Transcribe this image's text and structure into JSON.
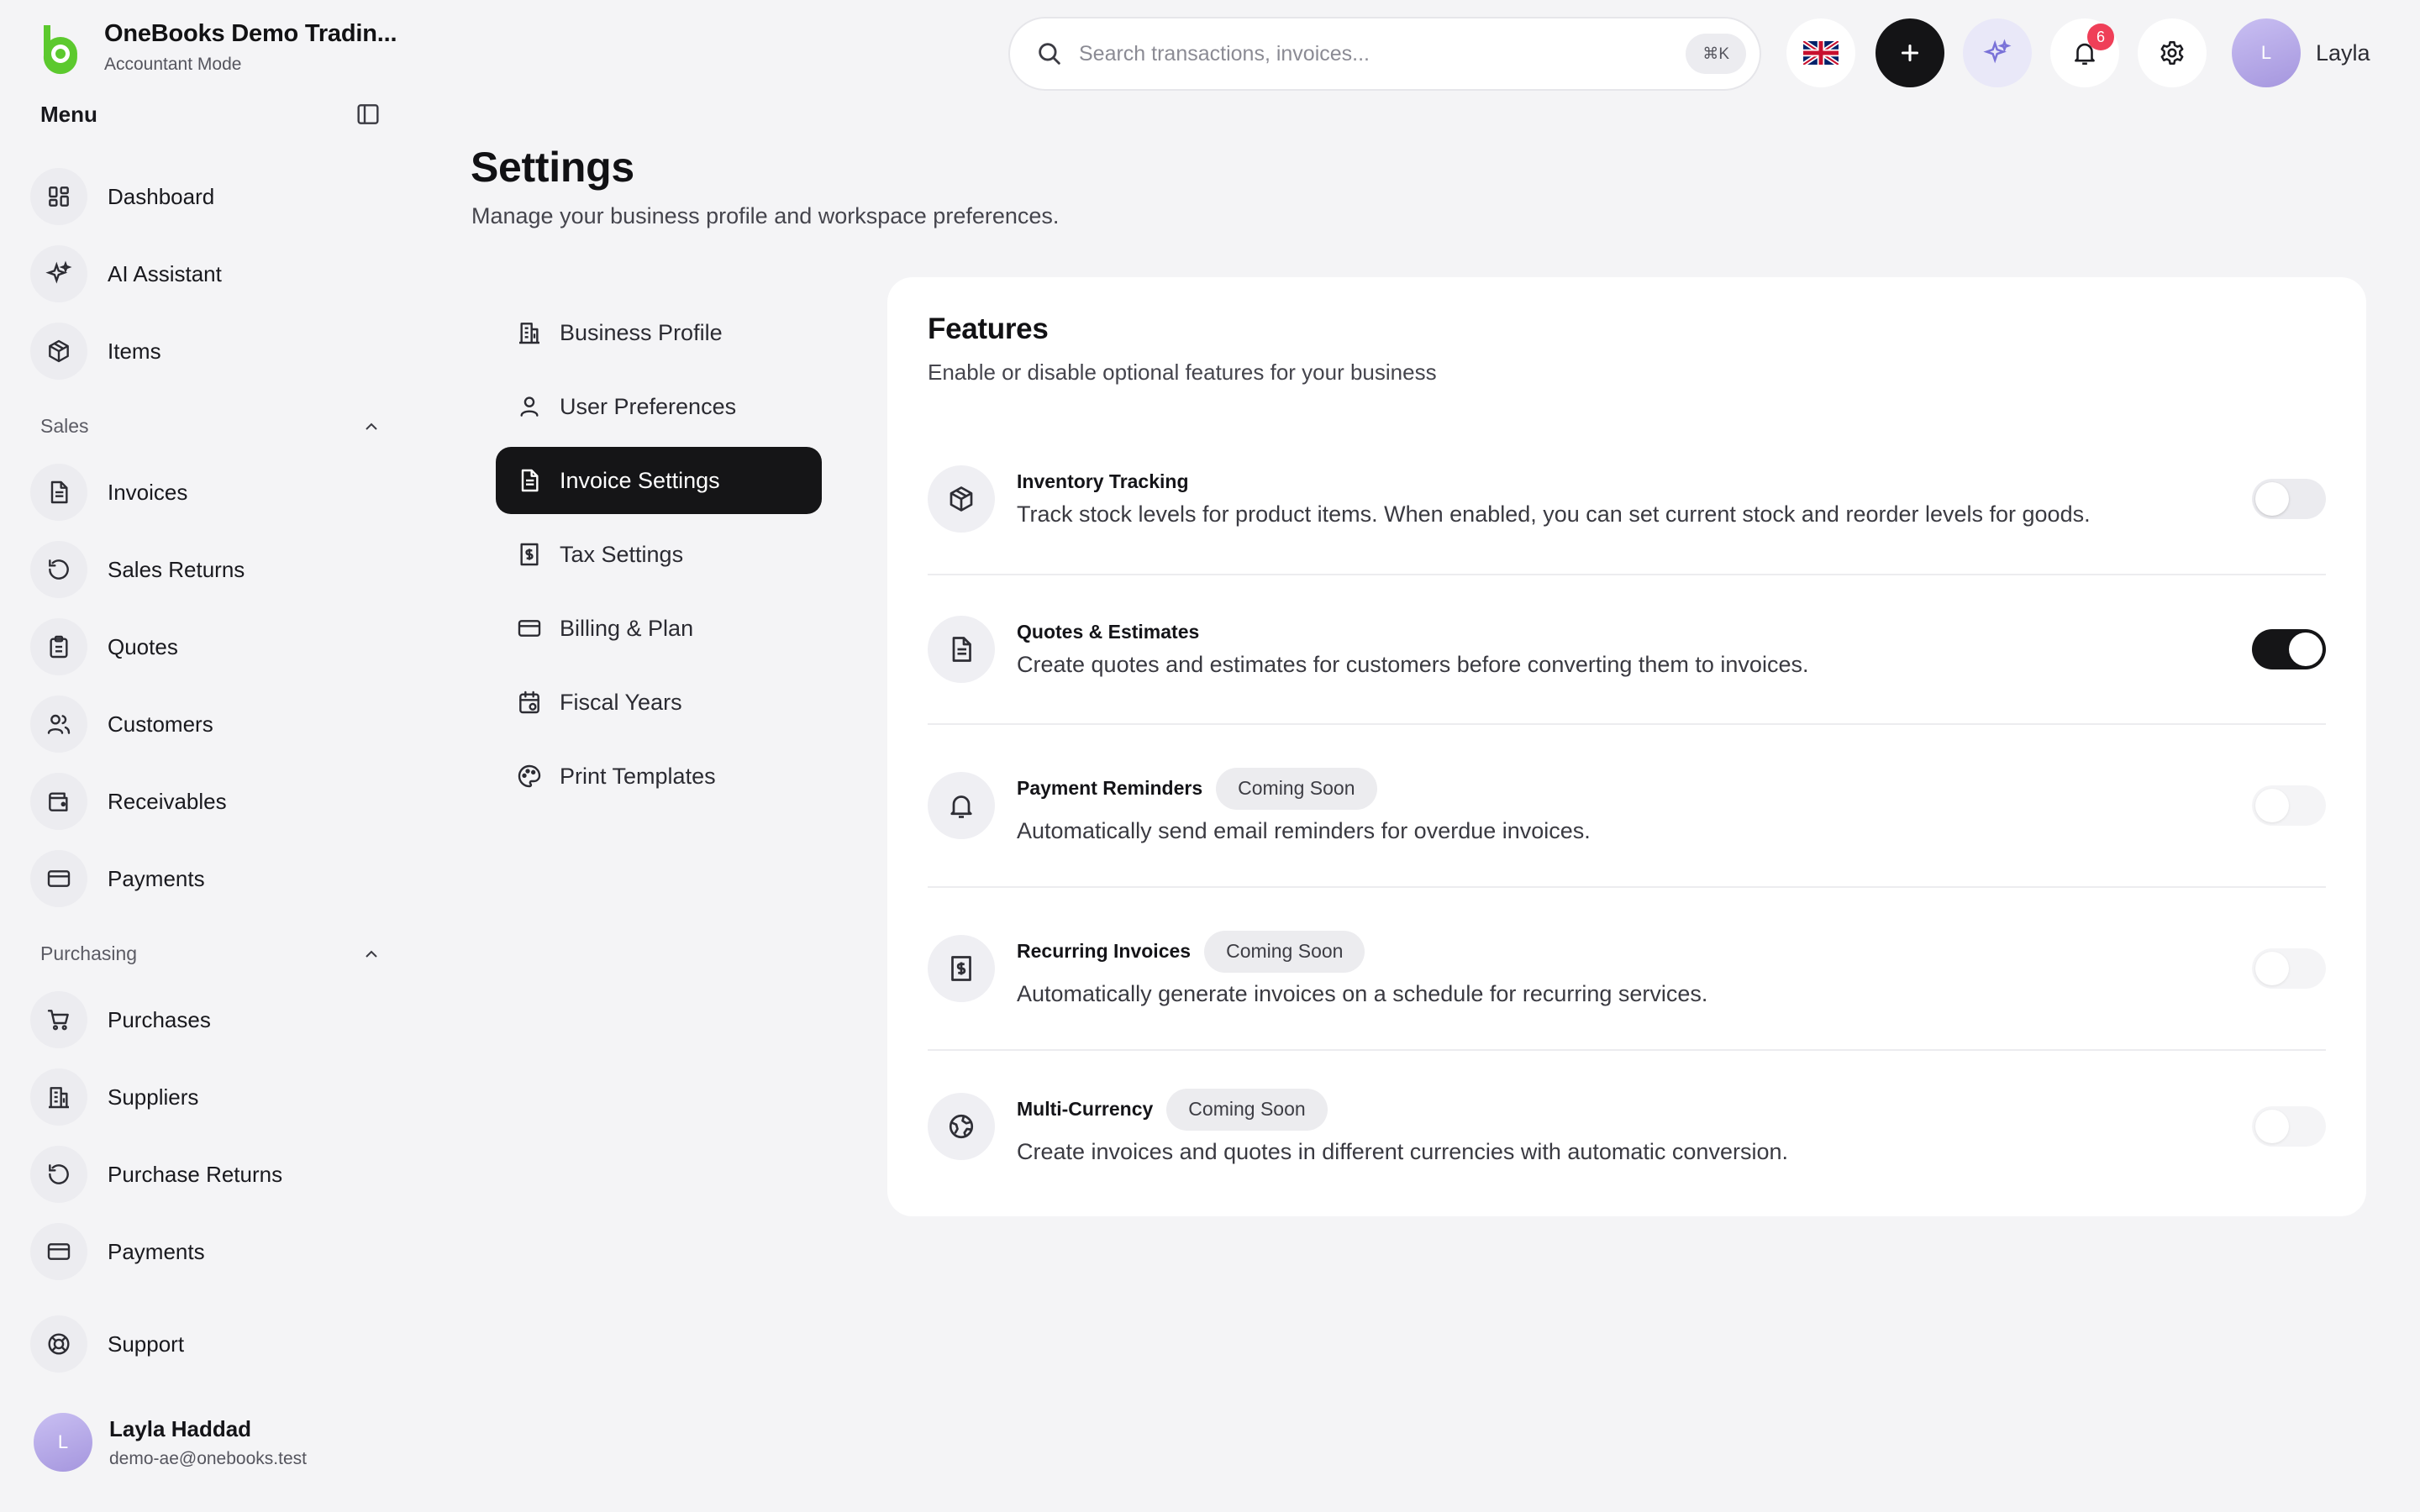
{
  "brand": {
    "name": "OneBooks Demo Tradin...",
    "mode": "Accountant Mode"
  },
  "colors": {
    "brand_green": "#5cc92e",
    "dark": "#151517",
    "badge_red": "#ef3f58",
    "accent_lavender": "#7a72d8"
  },
  "sidebar": {
    "menu_label": "Menu",
    "top_items": [
      {
        "label": "Dashboard",
        "icon": "dashboard-icon"
      },
      {
        "label": "AI Assistant",
        "icon": "sparkles-icon"
      },
      {
        "label": "Items",
        "icon": "box-icon"
      }
    ],
    "sales": {
      "label": "Sales",
      "items": [
        {
          "label": "Invoices",
          "icon": "invoice-icon"
        },
        {
          "label": "Sales Returns",
          "icon": "return-icon"
        },
        {
          "label": "Quotes",
          "icon": "clipboard-icon"
        },
        {
          "label": "Customers",
          "icon": "users-icon"
        },
        {
          "label": "Receivables",
          "icon": "wallet-icon"
        },
        {
          "label": "Payments",
          "icon": "card-icon"
        }
      ]
    },
    "purchasing": {
      "label": "Purchasing",
      "items": [
        {
          "label": "Purchases",
          "icon": "cart-icon"
        },
        {
          "label": "Suppliers",
          "icon": "building-icon"
        },
        {
          "label": "Purchase Returns",
          "icon": "return-icon"
        },
        {
          "label": "Payments",
          "icon": "card-icon"
        }
      ]
    },
    "support": {
      "label": "Support",
      "icon": "lifebuoy-icon"
    },
    "profile": {
      "initial": "L",
      "name": "Layla Haddad",
      "email": "demo-ae@onebooks.test"
    }
  },
  "topbar": {
    "search_placeholder": "Search transactions, invoices...",
    "shortcut": "⌘K",
    "notification_count": "6",
    "user": {
      "initial": "L",
      "name": "Layla"
    }
  },
  "page": {
    "title": "Settings",
    "subtitle": "Manage your business profile and workspace preferences."
  },
  "settings_nav": [
    {
      "label": "Business Profile",
      "icon": "building-icon",
      "active": false
    },
    {
      "label": "User Preferences",
      "icon": "user-icon",
      "active": false
    },
    {
      "label": "Invoice Settings",
      "icon": "document-icon",
      "active": true
    },
    {
      "label": "Tax Settings",
      "icon": "receipt-dollar-icon",
      "active": false
    },
    {
      "label": "Billing & Plan",
      "icon": "card-icon",
      "active": false
    },
    {
      "label": "Fiscal Years",
      "icon": "calendar-icon",
      "active": false
    },
    {
      "label": "Print Templates",
      "icon": "palette-icon",
      "active": false
    }
  ],
  "features": {
    "title": "Features",
    "subtitle": "Enable or disable optional features for your business",
    "items": [
      {
        "title": "Inventory Tracking",
        "badge": "",
        "description": "Track stock levels for product items. When enabled, you can set current stock and reorder levels for goods.",
        "icon": "box-icon",
        "enabled": false,
        "disabled": false
      },
      {
        "title": "Quotes & Estimates",
        "badge": "",
        "description": "Create quotes and estimates for customers before converting them to invoices.",
        "icon": "document-icon",
        "enabled": true,
        "disabled": false
      },
      {
        "title": "Payment Reminders",
        "badge": "Coming Soon",
        "description": "Automatically send email reminders for overdue invoices.",
        "icon": "bell-icon",
        "enabled": false,
        "disabled": true
      },
      {
        "title": "Recurring Invoices",
        "badge": "Coming Soon",
        "description": "Automatically generate invoices on a schedule for recurring services.",
        "icon": "receipt-dollar-icon",
        "enabled": false,
        "disabled": true
      },
      {
        "title": "Multi-Currency",
        "badge": "Coming Soon",
        "description": "Create invoices and quotes in different currencies with automatic conversion.",
        "icon": "globe-icon",
        "enabled": false,
        "disabled": true
      }
    ]
  }
}
